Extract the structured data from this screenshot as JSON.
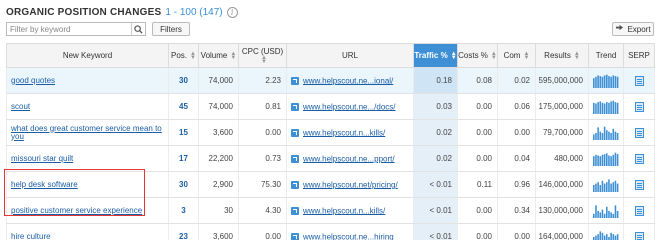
{
  "header": {
    "title": "ORGANIC POSITION CHANGES",
    "range": "1 - 100 (147)",
    "info_icon": "info-circle-icon"
  },
  "toolbar": {
    "search_placeholder": "Filter by keyword",
    "search_value": "",
    "filters_label": "Filters",
    "export_label": "Export"
  },
  "columns": [
    "New Keyword",
    "Pos.",
    "Volume",
    "CPC (USD)",
    "URL",
    "Traffic %",
    "Costs %",
    "Com",
    "Results",
    "Trend",
    "SERP"
  ],
  "accent_color": "#3d8fd6",
  "highlight_color": "#e23636",
  "rows": [
    {
      "keyword": "good quotes",
      "pos": "30",
      "volume": "74,000",
      "cpc": "2.23",
      "url": "www.helpscout.ne...ional/",
      "traffic": "0.18",
      "costs": "0.08",
      "com": "0.02",
      "results": "595,000,000",
      "trend": [
        0.7,
        0.8,
        0.9,
        0.85,
        0.8,
        0.9,
        0.95,
        0.85,
        0.8,
        0.9,
        0.85,
        0.8
      ]
    },
    {
      "keyword": "scout",
      "pos": "45",
      "volume": "74,000",
      "cpc": "0.81",
      "url": "www.helpscout.ne.../docs/",
      "traffic": "0.03",
      "costs": "0.00",
      "com": "0.06",
      "results": "175,000,000",
      "trend": [
        0.8,
        0.75,
        0.85,
        0.9,
        0.8,
        0.75,
        0.85,
        0.8,
        0.9,
        0.95,
        0.85,
        0.8
      ]
    },
    {
      "keyword": "what does great customer service mean to you",
      "pos": "15",
      "volume": "3,600",
      "cpc": "0.00",
      "url": "www.helpscout.n...kills/",
      "traffic": "0.02",
      "costs": "0.00",
      "com": "0.00",
      "results": "79,700,000",
      "trend": [
        0.4,
        0.5,
        0.9,
        0.6,
        0.5,
        0.95,
        0.7,
        0.6,
        0.5,
        0.8,
        0.6,
        0.5
      ]
    },
    {
      "keyword": "missouri star quilt",
      "pos": "17",
      "volume": "22,200",
      "cpc": "0.73",
      "url": "www.helpscout.ne...pport/",
      "traffic": "0.02",
      "costs": "0.00",
      "com": "0.04",
      "results": "480,000",
      "trend": [
        0.7,
        0.8,
        0.75,
        0.7,
        0.8,
        0.85,
        0.9,
        0.75,
        0.7,
        0.8,
        0.95,
        0.85
      ]
    },
    {
      "keyword": "help desk software",
      "pos": "30",
      "volume": "2,900",
      "cpc": "75.30",
      "url": "www.helpscout.net/pricing/",
      "traffic": "< 0.01",
      "costs": "0.11",
      "com": "0.96",
      "results": "146,000,000",
      "trend": [
        0.5,
        0.6,
        0.7,
        0.5,
        0.8,
        0.6,
        0.7,
        0.9,
        0.6,
        0.7,
        0.8,
        0.6
      ]
    },
    {
      "keyword": "positive customer service experience",
      "pos": "3",
      "volume": "30",
      "cpc": "4.30",
      "url": "www.helpscout.n...kills/",
      "traffic": "< 0.01",
      "costs": "0.00",
      "com": "0.34",
      "results": "130,000,000",
      "trend": [
        0.3,
        0.9,
        0.5,
        0.4,
        0.6,
        0.3,
        0.8,
        0.5,
        0.4,
        0.3,
        0.9,
        0.5
      ]
    },
    {
      "keyword": "hire culture",
      "pos": "23",
      "volume": "3,600",
      "cpc": "0.00",
      "url": "www.helpscout.ne...hiring",
      "traffic": "< 0.01",
      "costs": "0.00",
      "com": "0.00",
      "results": "164,000,000",
      "trend": [
        0.5,
        0.6,
        0.7,
        0.9,
        0.8,
        0.6,
        0.7,
        0.5,
        0.8,
        0.7,
        0.6,
        0.7
      ]
    }
  ]
}
